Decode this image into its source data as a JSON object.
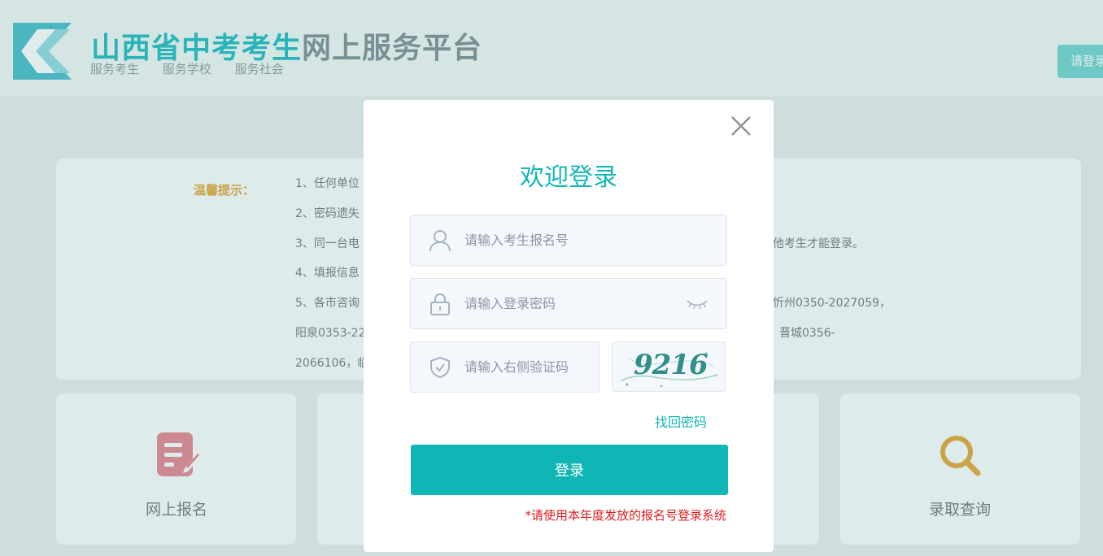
{
  "header": {
    "title_part1": "山西省中考考生",
    "title_part2": "网上服务平台",
    "slogans": [
      "服务考生",
      "服务学校",
      "服务社会"
    ],
    "login_link": "请登录"
  },
  "notice": {
    "label": "温馨提示：",
    "lines": [
      {
        "left": "1、任何单位",
        "right": ""
      },
      {
        "left": "2、密码遗失",
        "right": ""
      },
      {
        "left": "3、同一台电",
        "right": "他考生才能登录。"
      },
      {
        "left": "4、填报信息",
        "right": ""
      },
      {
        "left": "5、各市咨询",
        "right": "忻州0350-2027059，"
      },
      {
        "left": "阳泉0353-22",
        "right": "晋城0356-"
      },
      {
        "left": "2066106，临",
        "right": ""
      }
    ]
  },
  "services": [
    {
      "label": "网上报名",
      "icon": "edit-icon"
    },
    {
      "label": "录取查询",
      "icon": "search-icon"
    }
  ],
  "login": {
    "title": "欢迎登录",
    "username_placeholder": "请输入考生报名号",
    "password_placeholder": "请输入登录密码",
    "captcha_placeholder": "请输入右侧验证码",
    "captcha_value": "9216",
    "find_password": "找回密码",
    "submit_label": "登录",
    "hint": "*请使用本年度发放的报名号登录系统"
  },
  "colors": {
    "accent": "#14b6b8",
    "button": "#10b6b5",
    "warning": "#e21c1c",
    "notice_label": "#e3a22c"
  }
}
